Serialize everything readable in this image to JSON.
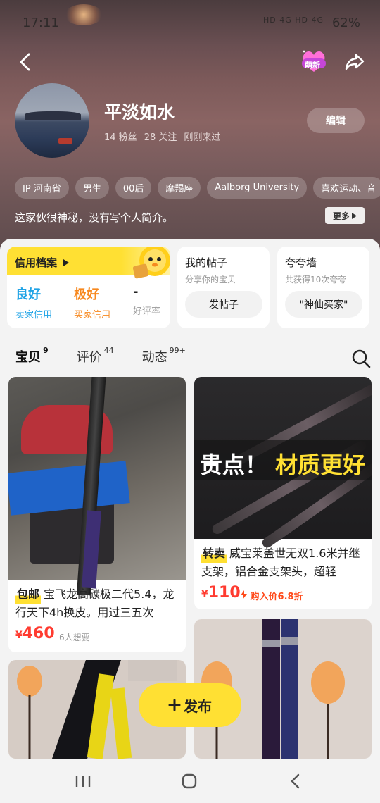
{
  "status_bar": {
    "time": "17:11",
    "signal": "HD 4G HD 4G",
    "battery": "62%"
  },
  "profile": {
    "name": "平淡如水",
    "followers": "14 粉丝",
    "following": "28 关注",
    "last_seen": "刚刚来过",
    "edit_label": "编辑",
    "badge_label": "萌新",
    "tags": [
      "IP 河南省",
      "男生",
      "00后",
      "摩羯座",
      "Aalborg University",
      "喜欢运动、音"
    ],
    "bio": "这家伙很神秘，没有写个人简介。",
    "more_label": "更多"
  },
  "credit": {
    "title": "信用档案",
    "seller_value": "良好",
    "seller_label": "卖家信用",
    "buyer_value": "极好",
    "buyer_label": "买家信用",
    "rate_value": "-",
    "rate_label": "好评率"
  },
  "posts_card": {
    "title": "我的帖子",
    "subtitle": "分享你的宝贝",
    "button": "发帖子"
  },
  "praise_card": {
    "title": "夸夸墙",
    "subtitle": "共获得10次夸夸",
    "button": "\"神仙买家\""
  },
  "tabs": [
    {
      "label": "宝贝",
      "count": "9"
    },
    {
      "label": "评价",
      "count": "44"
    },
    {
      "label": "动态",
      "count": "99+"
    }
  ],
  "products": [
    {
      "tag": "包邮",
      "title": "宝飞龙高碳极二代5.4，龙行天下4h换皮。用过三五次",
      "price_symbol": "¥",
      "price": "460",
      "want": "6人想要"
    },
    {
      "tag": "转卖",
      "title": "威宝莱盖世无双1.6米并继支架，铝合金支架头，超轻",
      "price_symbol": "¥",
      "price": "110",
      "buy_in": "购入价6.8折",
      "banner_white": "贵点！",
      "banner_yellow": "材质更好"
    }
  ],
  "publish_label": "发布",
  "colors": {
    "accent": "#ffe033",
    "price": "#ff3b30",
    "seller_credit": "#1fa3e6",
    "buyer_credit": "#f7881e"
  }
}
